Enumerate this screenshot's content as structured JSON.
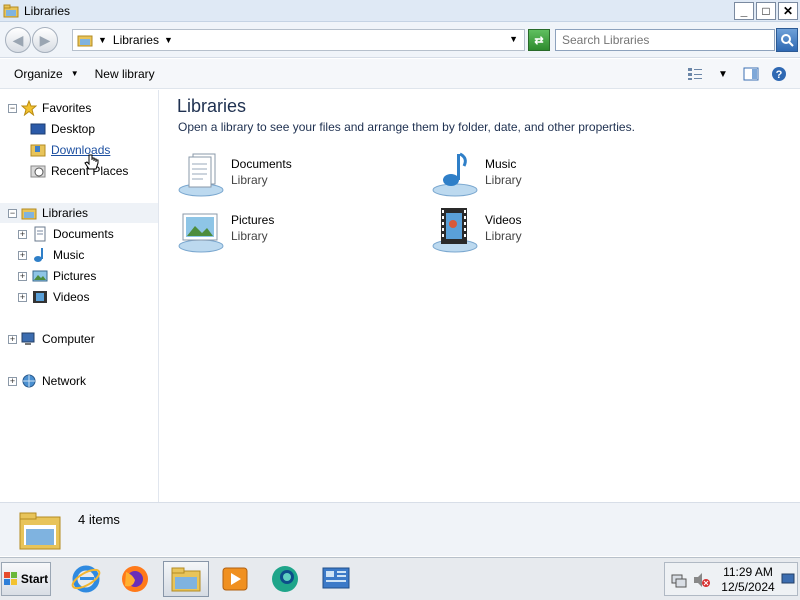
{
  "window": {
    "title": "Libraries"
  },
  "window_controls": {
    "minimize": "_",
    "maximize": "□",
    "close": "✕"
  },
  "address": {
    "crumb": "Libraries",
    "search_placeholder": "Search Libraries"
  },
  "toolbar": {
    "organize": "Organize",
    "new_library": "New library"
  },
  "nav": {
    "favorites": "Favorites",
    "desktop": "Desktop",
    "downloads": "Downloads",
    "recent_places": "Recent Places",
    "libraries": "Libraries",
    "documents": "Documents",
    "music": "Music",
    "pictures": "Pictures",
    "videos": "Videos",
    "computer": "Computer",
    "network": "Network"
  },
  "content": {
    "heading": "Libraries",
    "subtitle": "Open a library to see your files and arrange them by folder, date, and other properties.",
    "items": [
      {
        "name": "Documents",
        "type": "Library",
        "icon": "documents-library-icon"
      },
      {
        "name": "Music",
        "type": "Library",
        "icon": "music-library-icon"
      },
      {
        "name": "Pictures",
        "type": "Library",
        "icon": "pictures-library-icon"
      },
      {
        "name": "Videos",
        "type": "Library",
        "icon": "videos-library-icon"
      }
    ]
  },
  "details": {
    "count": "4 items"
  },
  "taskbar": {
    "start": "Start",
    "apps": [
      "internet-explorer-icon",
      "firefox-icon",
      "file-explorer-icon",
      "media-player-icon",
      "edge-icon",
      "control-panel-icon"
    ],
    "time": "11:29 AM",
    "date": "12/5/2024"
  },
  "colors": {
    "link": "#1c4fa0",
    "heading": "#1e3050",
    "accent": "#2f69b3"
  }
}
